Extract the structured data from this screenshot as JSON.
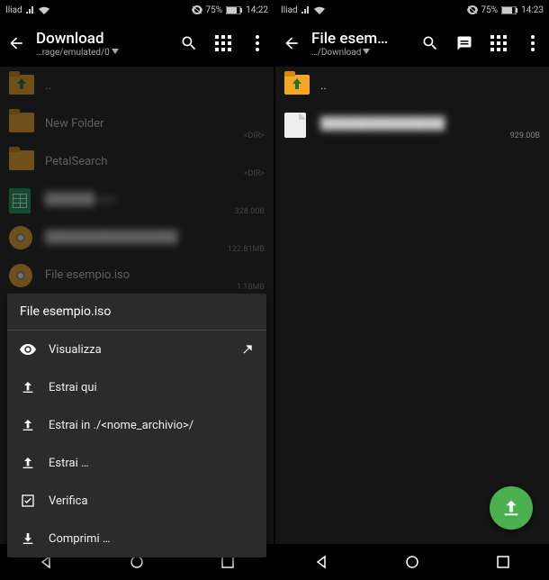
{
  "left": {
    "status": {
      "carrier": "Iliad",
      "battery": "75%",
      "time": "14:22"
    },
    "appbar": {
      "title": "Download",
      "subtitle": "…rage/emulated/0"
    },
    "rows": {
      "up": "..",
      "new_folder": "New Folder",
      "new_folder_meta": "<DIR>",
      "petal": "PetalSearch",
      "petal_meta": "<DIR>",
      "csv": "██████.csv",
      "csv_meta": "328.00B",
      "blur_big": "████████████████",
      "blur_big_meta": "122.81MB",
      "iso": "File esempio.iso",
      "iso_meta": "1.18MB"
    },
    "menu": {
      "title": "File esempio.iso",
      "view": "Visualizza",
      "extract_here": "Estrai qui",
      "extract_in": "Estrai in ./<nome_archivio>/",
      "extract": "Estrai …",
      "verify": "Verifica",
      "compress": "Comprimi …"
    }
  },
  "right": {
    "status": {
      "carrier": "Iliad",
      "battery": "75%",
      "time": "14:23"
    },
    "appbar": {
      "title": "File esem…",
      "subtitle": "…/Download"
    },
    "rows": {
      "up": "..",
      "file_blur": "███████████████",
      "file_meta": "929.00B"
    }
  }
}
